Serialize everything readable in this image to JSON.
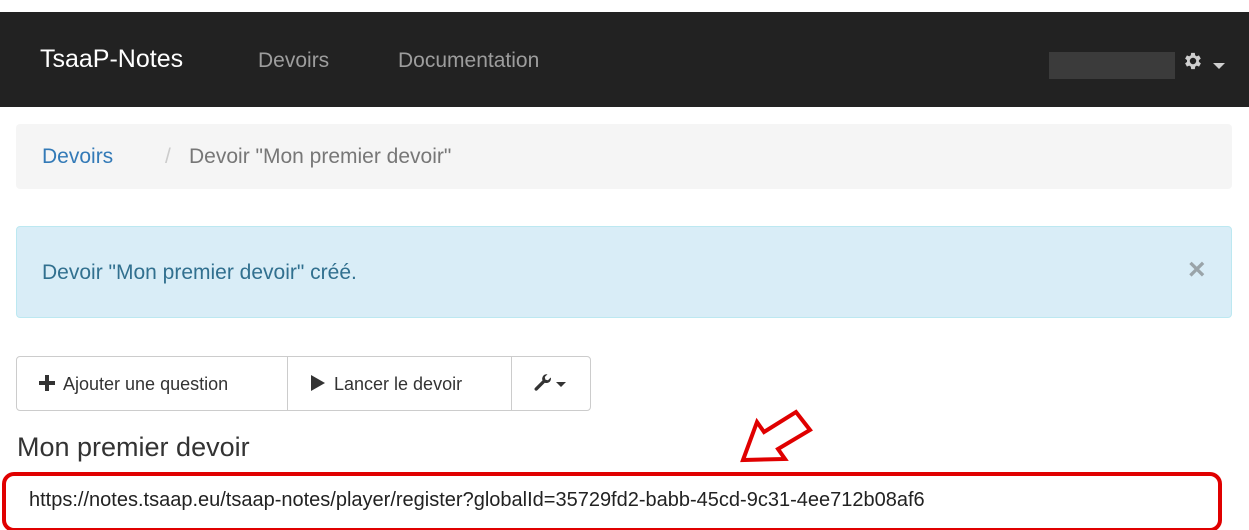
{
  "navbar": {
    "brand": "TsaaP-Notes",
    "links": [
      "Devoirs",
      "Documentation"
    ],
    "settings_icon": "gear-icon"
  },
  "breadcrumb": {
    "parent": "Devoirs",
    "separator": "/",
    "current": "Devoir \"Mon premier devoir\""
  },
  "alert": {
    "message": "Devoir \"Mon premier devoir\" créé.",
    "close": "×"
  },
  "toolbar": {
    "add_question": "Ajouter une question",
    "launch": "Lancer le devoir",
    "tools_icon": "wrench-icon"
  },
  "page": {
    "title": "Mon premier devoir",
    "register_url": "https://notes.tsaap.eu/tsaap-notes/player/register?globalId=35729fd2-babb-45cd-9c31-4ee712b08af6"
  },
  "colors": {
    "navbar_bg": "#222222",
    "link": "#337ab7",
    "alert_bg": "#d9edf7",
    "alert_text": "#31708f",
    "highlight": "#e00000"
  }
}
